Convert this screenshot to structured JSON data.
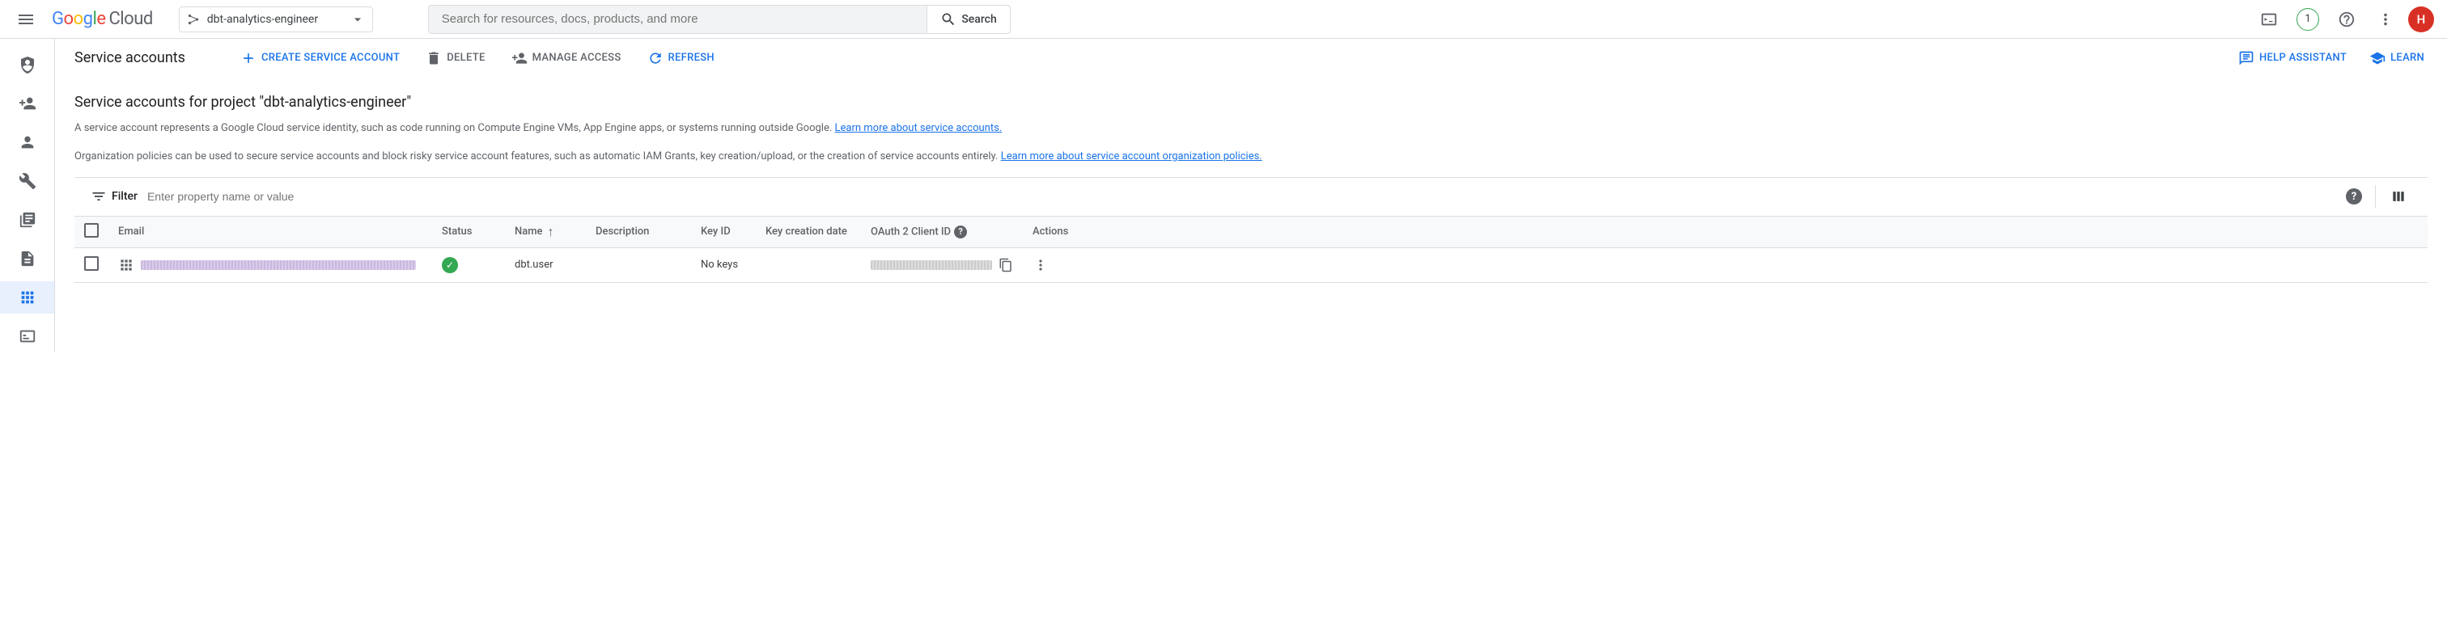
{
  "header": {
    "logo_cloud": "Cloud",
    "project_name": "dbt-analytics-engineer",
    "search_placeholder": "Search for resources, docs, products, and more",
    "search_button": "Search",
    "notification_count": "1",
    "avatar_initial": "H"
  },
  "action_bar": {
    "title": "Service accounts",
    "create": "CREATE SERVICE ACCOUNT",
    "delete": "DELETE",
    "manage": "MANAGE ACCESS",
    "refresh": "REFRESH",
    "help": "HELP ASSISTANT",
    "learn": "LEARN"
  },
  "content": {
    "subheading": "Service accounts for project \"dbt-analytics-engineer\"",
    "desc1_text": "A service account represents a Google Cloud service identity, such as code running on Compute Engine VMs, App Engine apps, or systems running outside Google. ",
    "desc1_link": "Learn more about service accounts.",
    "desc2_text": "Organization policies can be used to secure service accounts and block risky service account features, such as automatic IAM Grants, key creation/upload, or the creation of service accounts entirely. ",
    "desc2_link": "Learn more about service account organization policies."
  },
  "filter": {
    "label": "Filter",
    "placeholder": "Enter property name or value"
  },
  "table": {
    "columns": {
      "email": "Email",
      "status": "Status",
      "name": "Name",
      "description": "Description",
      "key_id": "Key ID",
      "key_creation": "Key creation date",
      "oauth": "OAuth 2 Client ID",
      "actions": "Actions"
    },
    "rows": [
      {
        "name": "dbt.user",
        "description": "",
        "key_id": "No keys",
        "key_creation": ""
      }
    ]
  }
}
